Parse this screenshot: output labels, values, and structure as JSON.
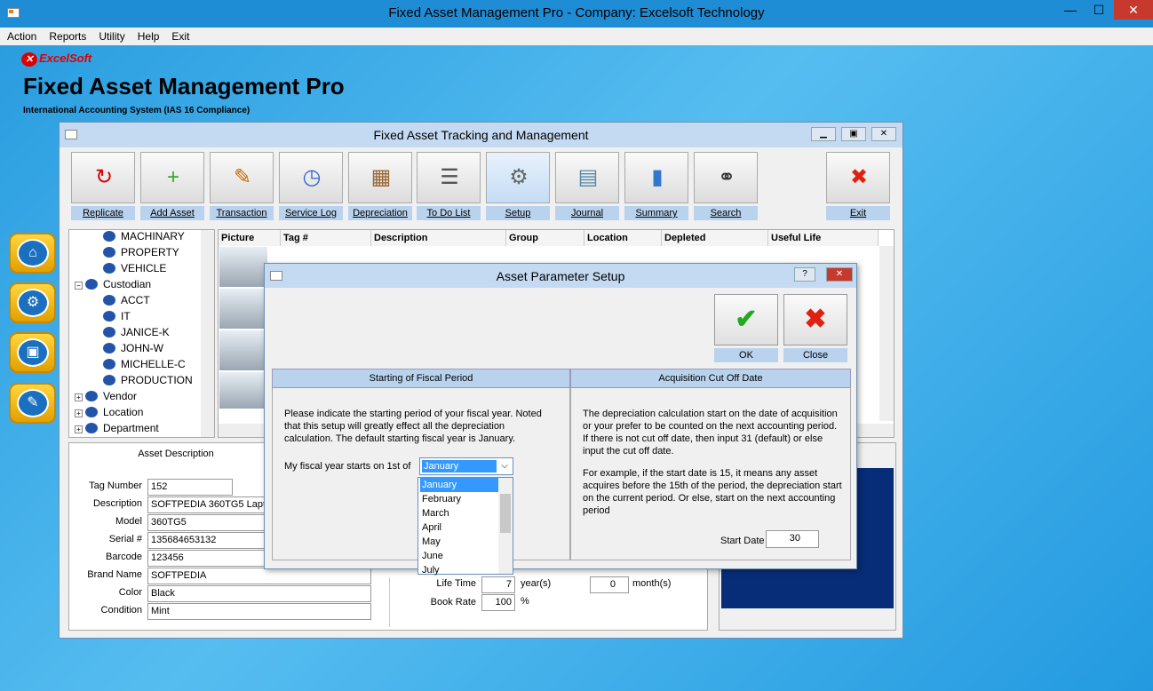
{
  "window": {
    "title": "Fixed Asset Management Pro - Company:  Excelsoft Technology",
    "min": "—",
    "max": "☐",
    "close": "✕"
  },
  "menu": [
    "Action",
    "Reports",
    "Utility",
    "Help",
    "Exit"
  ],
  "brand": {
    "logo": "ExcelSoft",
    "title": "Fixed Asset Management Pro",
    "subtitle": "International Accounting System (IAS 16 Compliance)"
  },
  "side_icons": [
    "home-icon",
    "gear-icon",
    "toolbox-icon",
    "edit-icon"
  ],
  "main": {
    "title": "Fixed Asset Tracking and Management"
  },
  "toolbar": [
    {
      "label": "Replicate",
      "icon": "replicate-icon",
      "glyph": "↻",
      "color": "#d00"
    },
    {
      "label": "Add Asset",
      "icon": "add-asset-icon",
      "glyph": "+",
      "color": "#3a3"
    },
    {
      "label": "Transaction",
      "icon": "transaction-icon",
      "glyph": "✎",
      "color": "#c60"
    },
    {
      "label": "Service Log",
      "icon": "service-log-icon",
      "glyph": "◷",
      "color": "#36c"
    },
    {
      "label": "Depreciation",
      "icon": "depreciation-icon",
      "glyph": "▦",
      "color": "#963"
    },
    {
      "label": "To Do List",
      "icon": "todo-list-icon",
      "glyph": "☰",
      "color": "#555"
    },
    {
      "label": "Setup",
      "icon": "setup-icon",
      "glyph": "⚙",
      "color": "#666"
    },
    {
      "label": "Journal",
      "icon": "journal-icon",
      "glyph": "▤",
      "color": "#58a"
    },
    {
      "label": "Summary",
      "icon": "summary-icon",
      "glyph": "▮",
      "color": "#37c"
    },
    {
      "label": "Search",
      "icon": "search-icon",
      "glyph": "⚭",
      "color": "#333"
    },
    {
      "label": "Exit",
      "icon": "exit-icon",
      "glyph": "✖",
      "color": "#e02010"
    }
  ],
  "tree": [
    {
      "label": "MACHINARY",
      "indent": 2
    },
    {
      "label": "PROPERTY",
      "indent": 2
    },
    {
      "label": "VEHICLE",
      "indent": 2
    },
    {
      "label": "Custodian",
      "indent": 1
    },
    {
      "label": "ACCT",
      "indent": 2
    },
    {
      "label": "IT",
      "indent": 2
    },
    {
      "label": "JANICE-K",
      "indent": 2
    },
    {
      "label": "JOHN-W",
      "indent": 2
    },
    {
      "label": "MICHELLE-C",
      "indent": 2
    },
    {
      "label": "PRODUCTION",
      "indent": 2
    },
    {
      "label": "Vendor",
      "indent": 1
    },
    {
      "label": "Location",
      "indent": 1
    },
    {
      "label": "Department",
      "indent": 1
    }
  ],
  "grid": {
    "columns": [
      "Picture",
      "Tag #",
      "Description",
      "Group",
      "Location",
      "Depleted",
      "Useful Life"
    ]
  },
  "detail": {
    "header": "Asset Description",
    "fields": [
      {
        "label": "Tag Number",
        "value": "152"
      },
      {
        "label": "Description",
        "value": "SOFTPEDIA 360TG5 Laptop"
      },
      {
        "label": "Model",
        "value": "360TG5"
      },
      {
        "label": "Serial #",
        "value": "135684653132"
      },
      {
        "label": "Barcode",
        "value": "123456"
      },
      {
        "label": "Brand Name",
        "value": "SOFTPEDIA"
      },
      {
        "label": "Color",
        "value": "Black"
      },
      {
        "label": "Condition",
        "value": "Mint"
      }
    ],
    "life_time_label": "Life Time",
    "life_time": "7",
    "years_unit": "year(s)",
    "months": "0",
    "months_unit": "month(s)",
    "book_rate_label": "Book Rate",
    "book_rate": "100",
    "pct": "%"
  },
  "dialog": {
    "title": "Asset Parameter Setup",
    "help": "?",
    "close": "✕",
    "ok_label": "OK",
    "close_label": "Close",
    "left_header": "Starting of Fiscal Period",
    "left_text": "Please indicate the starting period of your fiscal year.  Noted that this setup will greatly effect all the depreciation calculation. The default starting fiscal year is January.",
    "fiscal_label": "My fiscal year starts on 1st of",
    "fiscal_value": "January",
    "months": [
      "January",
      "February",
      "March",
      "April",
      "May",
      "June",
      "July"
    ],
    "right_header": "Acquisition Cut Off Date",
    "right_text1": "The depreciation calculation start on the date of acquisition or your prefer to be counted on the next accounting period. If there is not cut off date, then input 31 (default) or else input the cut off date.",
    "right_text2": "For example, if the start date is 15, it means any asset acquires before the 15th of the period, the depreciation start on the current period. Or else, start on the next accounting period",
    "start_date_label": "Start Date",
    "start_date": "30"
  }
}
